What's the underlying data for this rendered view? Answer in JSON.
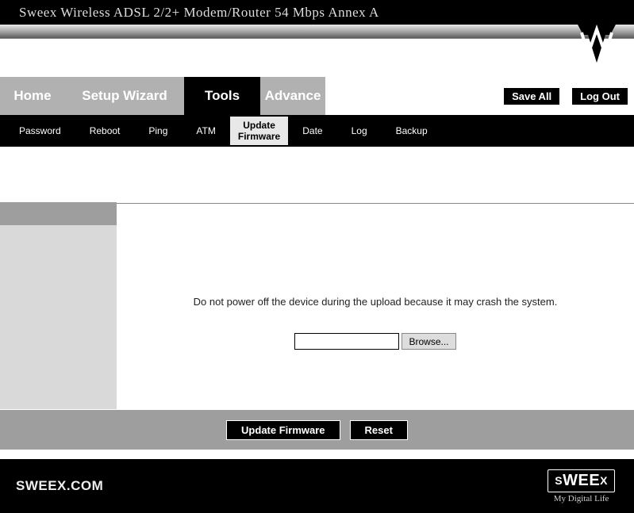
{
  "header": {
    "title": "Sweex Wireless ADSL 2/2+ Modem/Router 54 Mbps Annex A"
  },
  "mainTabs": {
    "home": "Home",
    "wizard": "Setup Wizard",
    "tools": "Tools",
    "advance": "Advance"
  },
  "topButtons": {
    "saveAll": "Save All",
    "logOut": "Log Out"
  },
  "subTabs": {
    "password": "Password",
    "reboot": "Reboot",
    "ping": "Ping",
    "atm": "ATM",
    "updateFirmware": "Update Firmware",
    "date": "Date",
    "log": "Log",
    "backup": "Backup"
  },
  "main": {
    "warning": "Do not power off the device during the upload because it may crash the system.",
    "fileValue": "",
    "browse": "Browse..."
  },
  "actionBar": {
    "update": "Update Firmware",
    "reset": "Reset"
  },
  "footer": {
    "site": "SWEEX.COM",
    "brand": "SWEEX",
    "tagline": "My Digital Life"
  }
}
